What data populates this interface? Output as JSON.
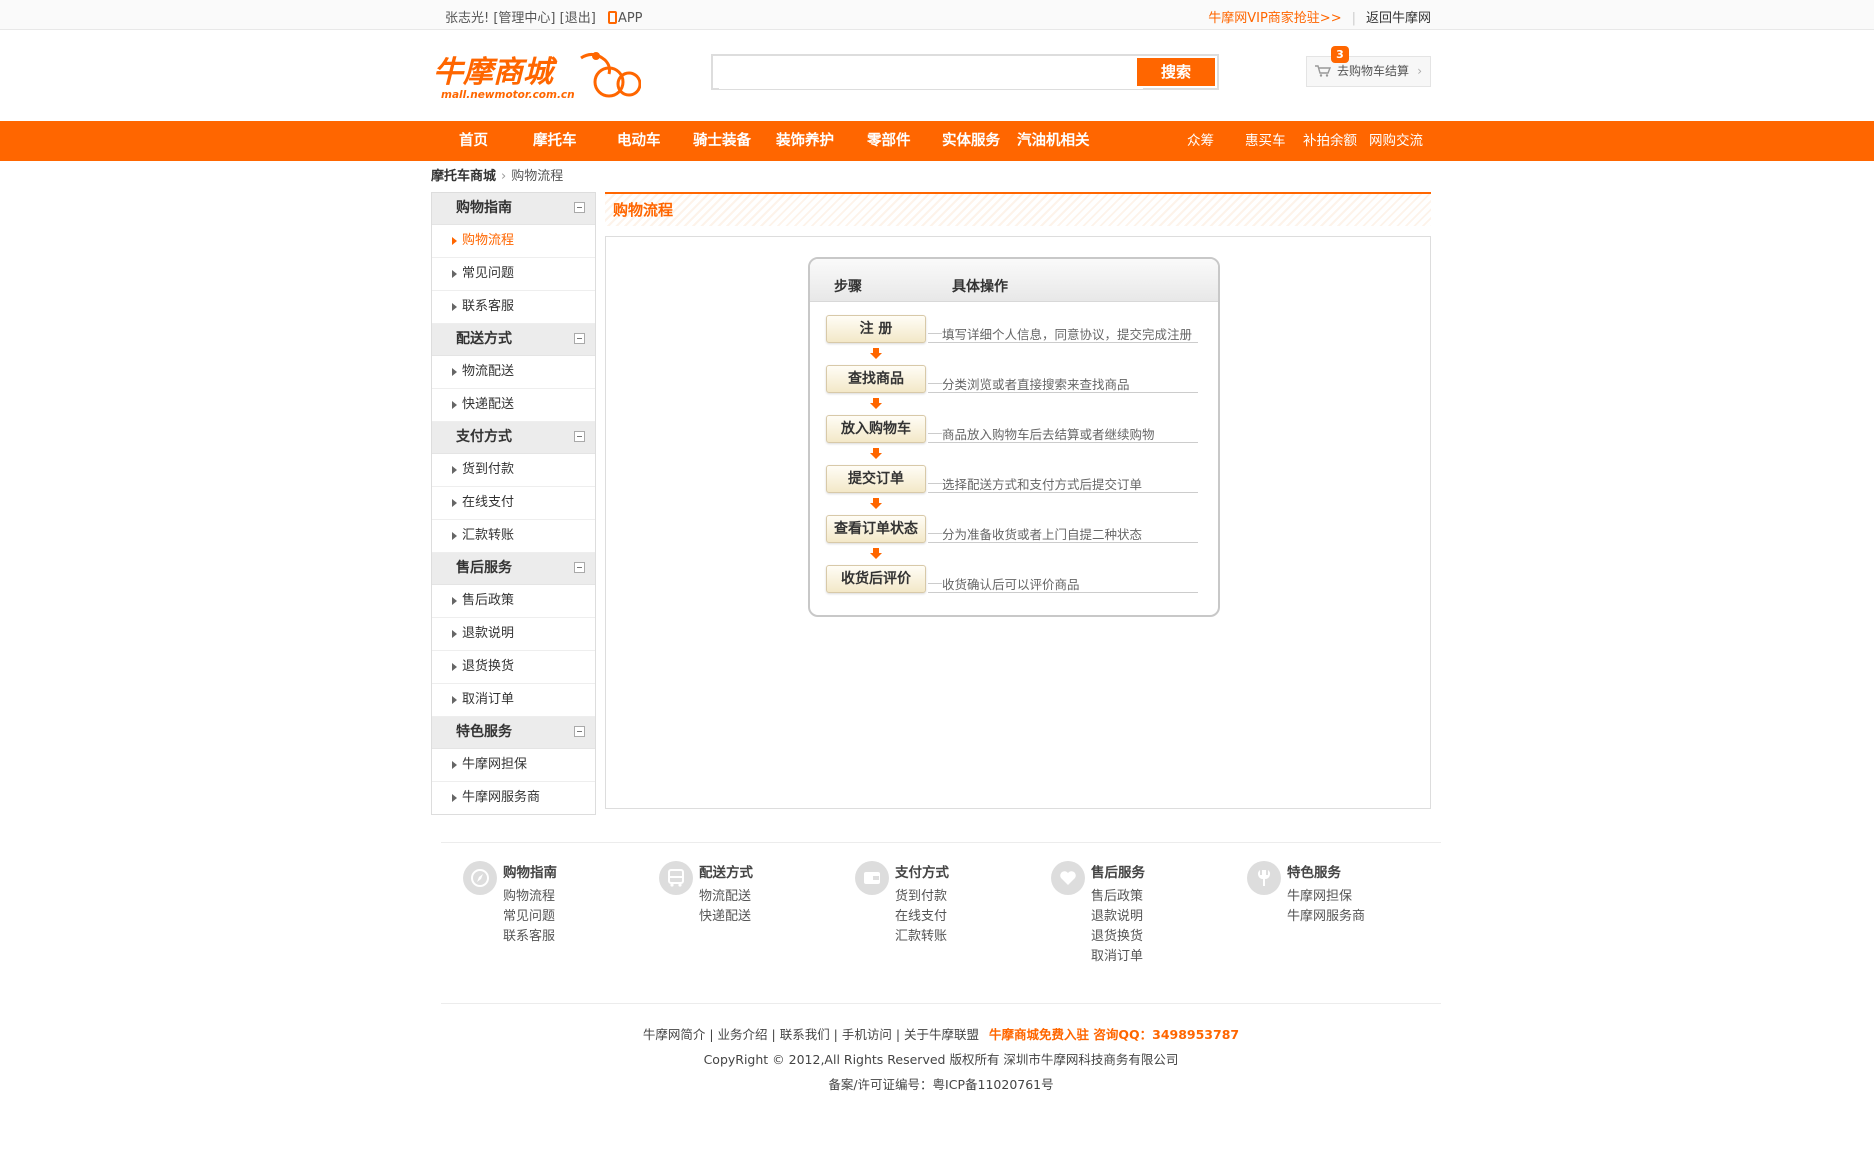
{
  "topbar": {
    "user": "张志光!",
    "admin": "[管理中心]",
    "logout": "[退出]",
    "app": "APP",
    "vip": "牛摩网VIP商家抢驻>>",
    "back": "返回牛摩网"
  },
  "logo": {
    "cn": "牛摩商城",
    "url_text": "mall.newmotor.com.cn"
  },
  "search": {
    "placeholder": "",
    "button": "搜索"
  },
  "cart": {
    "count": "3",
    "label": "去购物车结算"
  },
  "nav": {
    "main": [
      "首页",
      "摩托车",
      "电动车",
      "骑士装备",
      "装饰养护",
      "零部件",
      "实体服务",
      "汽油机相关"
    ],
    "right": [
      "众筹",
      "惠买车",
      "补拍余额",
      "网购交流"
    ]
  },
  "breadcrumb": {
    "root": "摩托车商城",
    "current": "购物流程"
  },
  "sidebar": [
    {
      "title": "购物指南",
      "items": [
        "购物流程",
        "常见问题",
        "联系客服"
      ]
    },
    {
      "title": "配送方式",
      "items": [
        "物流配送",
        "快递配送"
      ]
    },
    {
      "title": "支付方式",
      "items": [
        "货到付款",
        "在线支付",
        "汇款转账"
      ]
    },
    {
      "title": "售后服务",
      "items": [
        "售后政策",
        "退款说明",
        "退货换货",
        "取消订单"
      ]
    },
    {
      "title": "特色服务",
      "items": [
        "牛摩网担保",
        "牛摩网服务商"
      ]
    }
  ],
  "content": {
    "title": "购物流程",
    "flow_header": {
      "col1": "步骤",
      "col2": "具体操作"
    },
    "steps": [
      {
        "name": "注 册",
        "desc": "填写详细个人信息，同意协议，提交完成注册"
      },
      {
        "name": "查找商品",
        "desc": "分类浏览或者直接搜索来查找商品"
      },
      {
        "name": "放入购物车",
        "desc": "商品放入购物车后去结算或者继续购物"
      },
      {
        "name": "提交订单",
        "desc": "选择配送方式和支付方式后提交订单"
      },
      {
        "name": "查看订单状态",
        "desc": "分为准备收货或者上门自提二种状态"
      },
      {
        "name": "收货后评价",
        "desc": "收货确认后可以评价商品"
      }
    ]
  },
  "footer_cols": [
    {
      "title": "购物指南",
      "icon": "compass-icon",
      "links": [
        "购物流程",
        "常见问题",
        "联系客服"
      ]
    },
    {
      "title": "配送方式",
      "icon": "bus-icon",
      "links": [
        "物流配送",
        "快递配送"
      ]
    },
    {
      "title": "支付方式",
      "icon": "wallet-icon",
      "links": [
        "货到付款",
        "在线支付",
        "汇款转账"
      ]
    },
    {
      "title": "售后服务",
      "icon": "heart-icon",
      "links": [
        "售后政策",
        "退款说明",
        "退货换货",
        "取消订单"
      ]
    },
    {
      "title": "特色服务",
      "icon": "wrench-icon",
      "links": [
        "牛摩网担保",
        "牛摩网服务商"
      ]
    }
  ],
  "bottom": {
    "links": "牛摩网简介 | 业务介绍 | 联系我们 | 手机访问 | 关于牛摩联盟",
    "promo": "牛摩商城免费入驻 咨询QQ：3498953787",
    "copyright": "CopyRight © 2012,All Rights Reserved 版权所有 深圳市牛摩网科技商务有限公司",
    "icp": "备案/许可证编号：粤ICP备11020761号"
  },
  "colors": {
    "accent": "#ff6600",
    "border": "#dddddd"
  }
}
